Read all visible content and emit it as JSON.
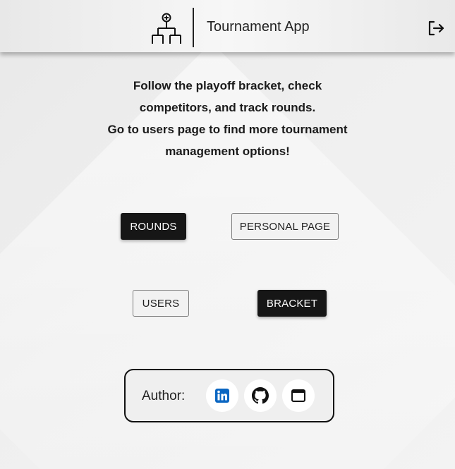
{
  "header": {
    "title": "Tournament App",
    "logo_icon": "bracket-icon",
    "logout_icon": "logout-icon"
  },
  "intro": {
    "line1": "Follow the playoff bracket, check",
    "line2": "competitors, and track rounds.",
    "line3": "Go to users page to find more tournament",
    "line4": "management options!"
  },
  "nav": {
    "rounds_label": "ROUNDS",
    "personal_page_label": "PERSONAL PAGE",
    "users_label": "USERS",
    "bracket_label": "BRACKET"
  },
  "author": {
    "label": "Author:",
    "links": [
      {
        "icon": "linkedin-icon",
        "color": "#0a66c2"
      },
      {
        "icon": "github-icon",
        "color": "#111111"
      },
      {
        "icon": "window-icon",
        "color": "#111111"
      }
    ]
  },
  "colors": {
    "dark_button": "#161616",
    "background": "#efefef",
    "linkedin": "#0a66c2"
  }
}
